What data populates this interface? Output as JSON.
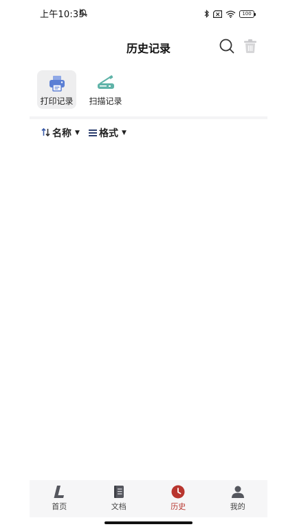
{
  "status_bar": {
    "time": "上午10:35",
    "battery": "100"
  },
  "header": {
    "title": "历史记录"
  },
  "record_tabs": [
    {
      "label": "打印记录",
      "active": true,
      "icon": "printer-icon"
    },
    {
      "label": "扫描记录",
      "active": false,
      "icon": "scanner-icon"
    }
  ],
  "sort_bar": {
    "sort_label": "名称",
    "format_label": "格式"
  },
  "bottom_nav": [
    {
      "label": "首页",
      "icon": "home-logo-icon",
      "active": false
    },
    {
      "label": "文档",
      "icon": "document-icon",
      "active": false
    },
    {
      "label": "历史",
      "icon": "clock-icon",
      "active": true
    },
    {
      "label": "我的",
      "icon": "person-icon",
      "active": false
    }
  ],
  "colors": {
    "accent": "#b8352e",
    "printer": "#5b7fd4",
    "scanner": "#5fb3a8"
  }
}
